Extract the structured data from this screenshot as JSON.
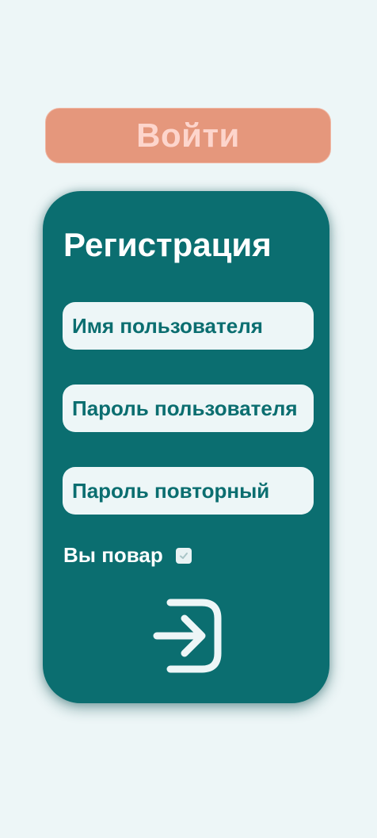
{
  "login": {
    "label": "Войти"
  },
  "register": {
    "title": "Регистрация",
    "username_placeholder": "Имя пользователя",
    "password_placeholder": "Пароль пользователя",
    "password_repeat_placeholder": "Пароль повторный",
    "chef_label": "Вы повар",
    "chef_checked": true,
    "submit_icon": "login-arrow-icon"
  },
  "colors": {
    "background": "#edf6f7",
    "card": "#0b6e70",
    "login_button": "#e5977c",
    "login_text": "#fdd5cc",
    "field_background": "#edf6f7",
    "field_text": "#0b6e70"
  }
}
